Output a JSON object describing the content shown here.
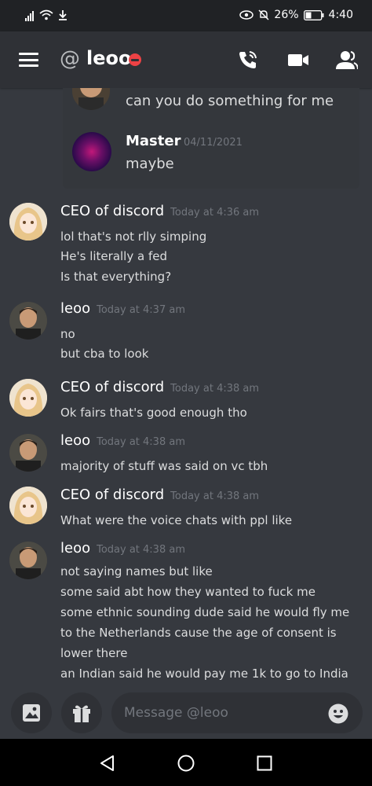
{
  "status": {
    "battery": "26%",
    "time": "4:40"
  },
  "header": {
    "at": "@",
    "title": "leoo"
  },
  "reply": {
    "snippet": "can you do something for me",
    "author": "Master",
    "date": "04/11/2021",
    "text": "maybe"
  },
  "messages": [
    {
      "author": "CEO of discord",
      "time": "Today at 4:36 am",
      "lines": [
        "lol that's not rlly simping",
        "He's literally a fed",
        "Is that everything?"
      ]
    },
    {
      "author": "leoo",
      "time": "Today at 4:37 am",
      "lines": [
        "no",
        "but cba to look"
      ]
    },
    {
      "author": "CEO of discord",
      "time": "Today at 4:38 am",
      "lines": [
        "Ok fairs that's good enough tho"
      ]
    },
    {
      "author": "leoo",
      "time": "Today at 4:38 am",
      "lines": [
        "majority of stuff was said on vc tbh"
      ]
    },
    {
      "author": "CEO of discord",
      "time": "Today at 4:38 am",
      "lines": [
        "What were the voice chats with ppl like"
      ]
    },
    {
      "author": "leoo",
      "time": "Today at 4:38 am",
      "lines": [
        "not saying names but like",
        "some said abt how they wanted to fuck me",
        "some ethnic sounding dude said he would fly me",
        "to the Netherlands cause the age of consent is",
        "lower there",
        "an Indian said he would pay me 1k to go to India"
      ]
    }
  ],
  "composer": {
    "placeholder": "Message @leoo"
  }
}
